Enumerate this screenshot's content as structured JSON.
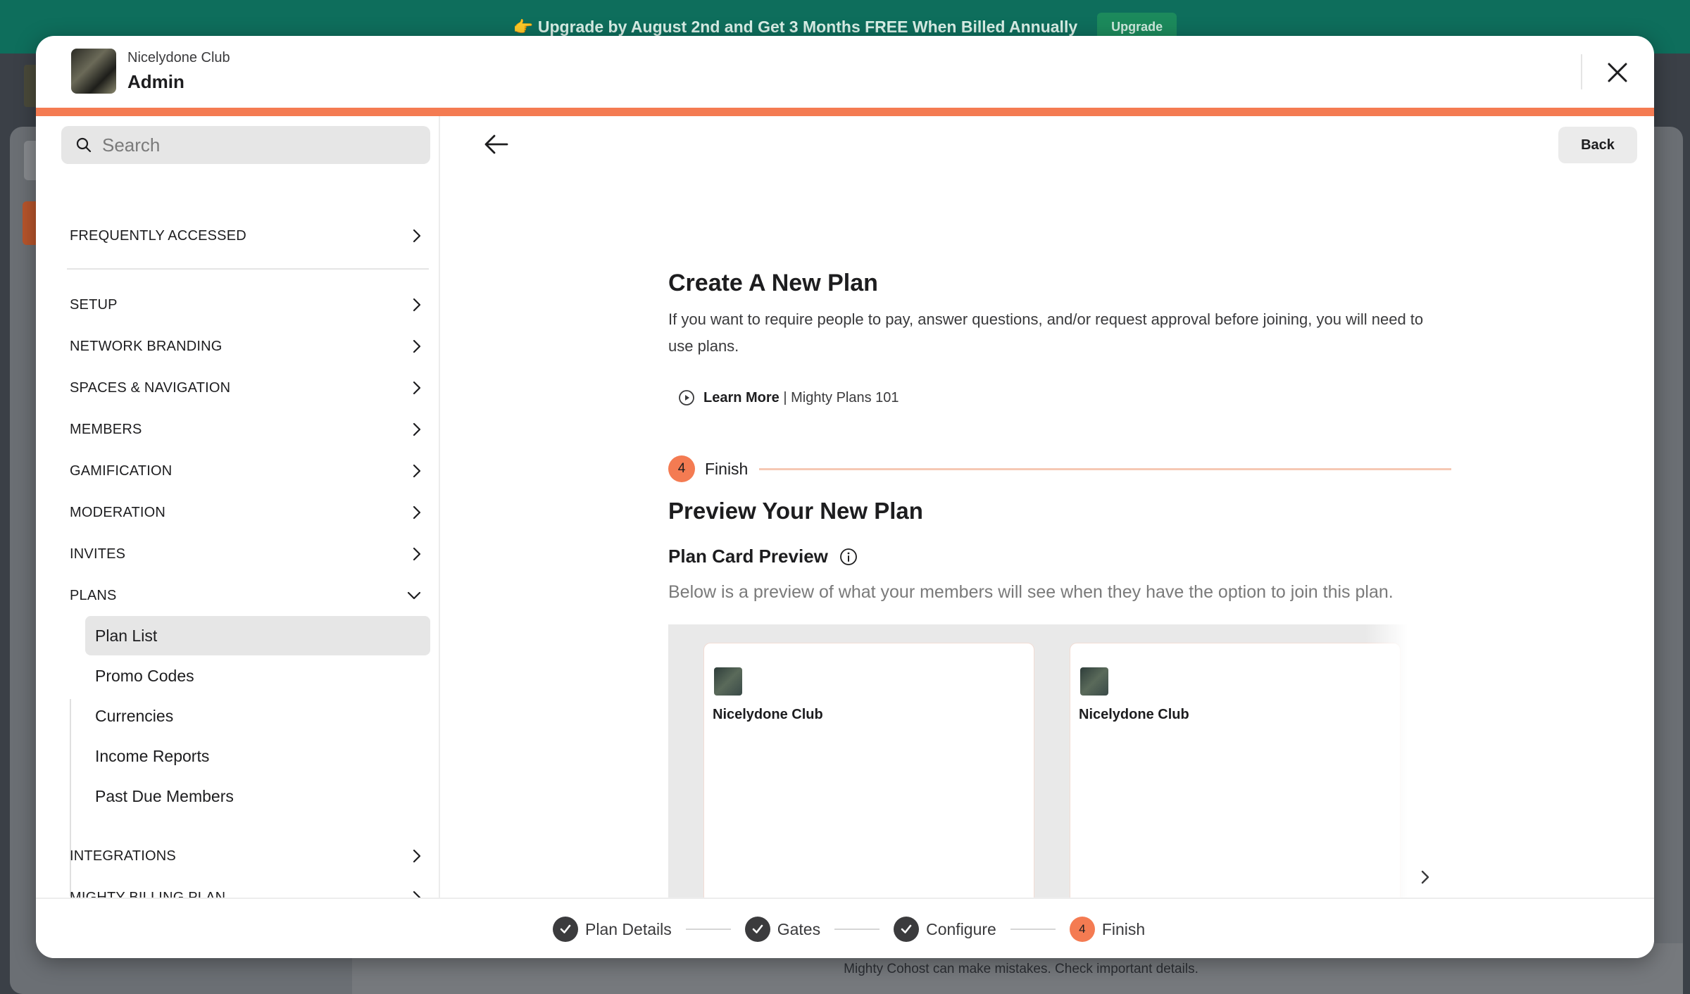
{
  "banner": {
    "text": "👉 Upgrade by August 2nd and Get 3 Months FREE When Billed Annually",
    "button": "Upgrade"
  },
  "disclaimer": "Mighty Cohost can make mistakes. Check important details.",
  "header": {
    "org_name": "Nicelydone Club",
    "role": "Admin",
    "close_icon": "close-icon"
  },
  "sidebar": {
    "search_placeholder": "Search",
    "items": [
      {
        "label": "FREQUENTLY ACCESSED",
        "icon": "chevron-right-icon"
      },
      {
        "label": "SETUP",
        "icon": "chevron-right-icon"
      },
      {
        "label": "NETWORK BRANDING",
        "icon": "chevron-right-icon"
      },
      {
        "label": "SPACES & NAVIGATION",
        "icon": "chevron-right-icon"
      },
      {
        "label": "MEMBERS",
        "icon": "chevron-right-icon"
      },
      {
        "label": "GAMIFICATION",
        "icon": "chevron-right-icon"
      },
      {
        "label": "MODERATION",
        "icon": "chevron-right-icon"
      },
      {
        "label": "INVITES",
        "icon": "chevron-right-icon"
      },
      {
        "label": "PLANS",
        "icon": "chevron-down-icon"
      },
      {
        "label": "INTEGRATIONS",
        "icon": "chevron-right-icon"
      },
      {
        "label": "MIGHTY BILLING PLAN",
        "icon": "chevron-right-icon"
      }
    ],
    "plans_sub": [
      "Plan List",
      "Promo Codes",
      "Currencies",
      "Income Reports",
      "Past Due Members"
    ],
    "active_sub": "Plan List"
  },
  "main": {
    "back_button": "Back",
    "title": "Create A New Plan",
    "description": "If you want to require people to pay, answer questions, and/or request approval before joining, you will need to use plans.",
    "learn_more_bold": "Learn More",
    "learn_more_rest": " | Mighty Plans 101",
    "step_number": "4",
    "step_label": "Finish",
    "preview_title": "Preview Your New Plan",
    "card_preview_title": "Plan Card Preview",
    "card_preview_desc": "Below is a preview of what your members will see when they have the option to join this plan.",
    "cards": [
      {
        "name": "Nicelydone Club"
      },
      {
        "name": "Nicelydone Club"
      }
    ]
  },
  "stepper": {
    "steps": [
      {
        "label": "Plan Details",
        "state": "done"
      },
      {
        "label": "Gates",
        "state": "done"
      },
      {
        "label": "Configure",
        "state": "done"
      },
      {
        "label": "Finish",
        "state": "current",
        "number": "4"
      }
    ]
  },
  "colors": {
    "accent": "#f47b52",
    "banner": "#0e6e5c"
  }
}
